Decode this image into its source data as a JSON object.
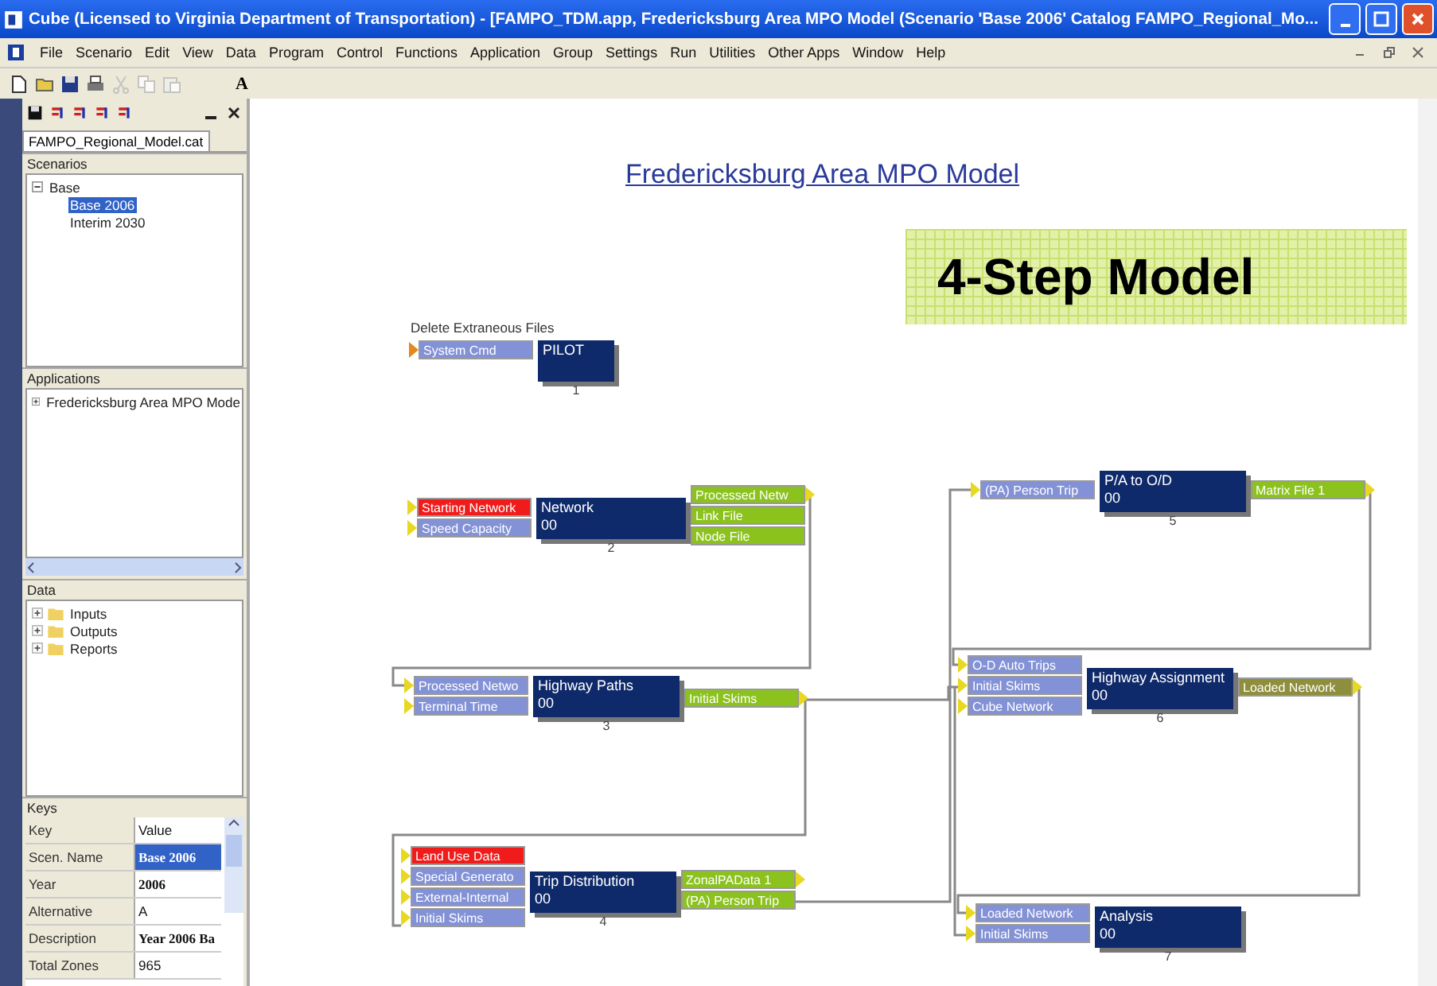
{
  "window": {
    "title": "Cube (Licensed to Virginia Department of Transportation) - [FAMPO_TDM.app, Fredericksburg Area MPO Model (Scenario 'Base 2006' Catalog FAMPO_Regional_Mo..."
  },
  "menu": [
    "File",
    "Scenario",
    "Edit",
    "View",
    "Data",
    "Program",
    "Control",
    "Functions",
    "Application",
    "Group",
    "Settings",
    "Run",
    "Utilities",
    "Other Apps",
    "Window",
    "Help"
  ],
  "toolbar": {
    "text_tool": "A"
  },
  "catalog": {
    "tab": "FAMPO_Regional_Model.cat",
    "scenarios": {
      "title": "Scenarios",
      "items": [
        {
          "label": "Base",
          "expanded": true,
          "selected": false,
          "children": [
            {
              "label": "Base 2006",
              "selected": true
            },
            {
              "label": "Interim 2030",
              "selected": false
            }
          ]
        }
      ]
    },
    "applications": {
      "title": "Applications",
      "items": [
        {
          "label": "Fredericksburg Area MPO Mode",
          "expanded": false
        }
      ]
    },
    "data": {
      "title": "Data",
      "items": [
        {
          "label": "Inputs",
          "expanded": false
        },
        {
          "label": "Outputs",
          "expanded": false
        },
        {
          "label": "Reports",
          "expanded": false
        }
      ]
    },
    "keys": {
      "title": "Keys",
      "columns": [
        "Key",
        "Value"
      ],
      "rows": [
        {
          "key": "Scen. Name",
          "value": "Base 2006",
          "bold": true,
          "selected": true
        },
        {
          "key": "Year",
          "value": "2006",
          "bold": true,
          "selected": false
        },
        {
          "key": "Alternative",
          "value": "A",
          "bold": false,
          "selected": false
        },
        {
          "key": "Description",
          "value": "Year 2006 Ba",
          "bold": true,
          "selected": false
        },
        {
          "key": "Total Zones",
          "value": "965",
          "bold": false,
          "selected": false
        }
      ]
    }
  },
  "canvas": {
    "heading": "Fredericksburg Area MPO Model",
    "banner": "4-Step Model",
    "modules": [
      {
        "caption": "Delete Extraneous Files",
        "inputs": [
          {
            "label": "System Cmd",
            "color": "#8392d6"
          }
        ],
        "name": "PILOT",
        "number": "1"
      },
      {
        "inputs": [
          {
            "label": "Starting Network",
            "color": "#f01c1c"
          },
          {
            "label": "Speed Capacity",
            "color": "#8392d6"
          }
        ],
        "name": "Network",
        "code": "00",
        "number": "2",
        "outputs": [
          {
            "label": "Processed Netw",
            "color": "#8cc21e"
          },
          {
            "label": "Link File",
            "color": "#8cc21e"
          },
          {
            "label": "Node File",
            "color": "#8cc21e"
          }
        ]
      },
      {
        "inputs": [
          {
            "label": "Processed Netwo",
            "color": "#8392d6"
          },
          {
            "label": "Terminal Time",
            "color": "#8392d6"
          }
        ],
        "name": "Highway Paths",
        "code": "00",
        "number": "3",
        "outputs": [
          {
            "label": "Initial Skims",
            "color": "#8cc21e"
          }
        ]
      },
      {
        "inputs": [
          {
            "label": "Land Use Data",
            "color": "#f01c1c"
          },
          {
            "label": "Special Generato",
            "color": "#8392d6"
          },
          {
            "label": "External-Internal",
            "color": "#8392d6"
          },
          {
            "label": "Initial Skims",
            "color": "#8392d6"
          }
        ],
        "name": "Trip Distribution",
        "code": "00",
        "number": "4",
        "outputs": [
          {
            "label": "ZonalPAData 1",
            "color": "#8cc21e"
          },
          {
            "label": "(PA) Person Trip",
            "color": "#8cc21e"
          }
        ]
      },
      {
        "inputs": [
          {
            "label": "(PA) Person Trip",
            "color": "#8392d6"
          }
        ],
        "name": "P/A to O/D",
        "code": "00",
        "number": "5",
        "outputs": [
          {
            "label": "Matrix File 1",
            "color": "#8cc21e"
          }
        ]
      },
      {
        "inputs": [
          {
            "label": "O-D Auto Trips",
            "color": "#8392d6"
          },
          {
            "label": "Initial Skims",
            "color": "#8392d6"
          },
          {
            "label": "Cube Network",
            "color": "#8392d6"
          }
        ],
        "name": "Highway Assignment",
        "code": "00",
        "number": "6",
        "outputs": [
          {
            "label": "Loaded Network",
            "color": "#8e8e3c"
          }
        ]
      },
      {
        "inputs": [
          {
            "label": "Loaded Network",
            "color": "#8392d6"
          },
          {
            "label": "Initial Skims",
            "color": "#8392d6"
          }
        ],
        "name": "Analysis",
        "code": "00",
        "number": "7"
      }
    ]
  }
}
